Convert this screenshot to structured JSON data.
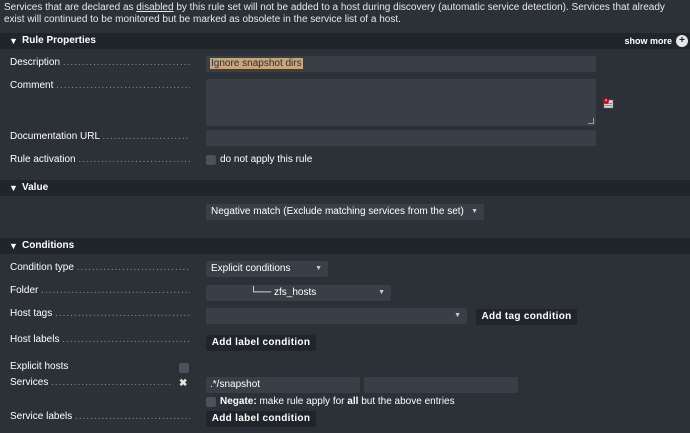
{
  "intro": {
    "part1": "Services that are declared as ",
    "link": "disabled",
    "part2": " by this rule set will not be added to a host during discovery (automatic service detection). Services that already exist will continued to be monitored but be marked as obsolete in the service list of a host."
  },
  "rule_properties": {
    "title": "Rule Properties",
    "show_more": "show more",
    "description_label": "Description",
    "description_value": "Ignore snapshot dirs",
    "comment_label": "Comment",
    "comment_value": "",
    "doc_url_label": "Documentation URL",
    "doc_url_value": "",
    "activation_label": "Rule activation",
    "activation_text": "do not apply this rule"
  },
  "value": {
    "title": "Value",
    "match_selected": "Negative match (Exclude matching services from the set)"
  },
  "conditions": {
    "title": "Conditions",
    "condition_type_label": "Condition type",
    "condition_type_value": "Explicit conditions",
    "folder_label": "Folder",
    "folder_value": "└── zfs_hosts",
    "host_tags_label": "Host tags",
    "host_tags_value": "",
    "add_tag_condition": "Add tag condition",
    "host_labels_label": "Host labels",
    "add_label_condition": "Add label condition",
    "explicit_hosts_label": "Explicit hosts",
    "services_label": "Services",
    "service_value_1": ".*/snapshot",
    "service_value_2": "",
    "negate_bold": "Negate:",
    "negate_text_1": " make rule apply for ",
    "negate_all": "all",
    "negate_text_2": " but the above entries",
    "service_labels_label": "Service labels",
    "add_service_label_condition": "Add label condition"
  },
  "colors": {
    "background": "#2b3137",
    "header": "#1f252b",
    "input": "#383f47",
    "highlight": "#c8a57a"
  }
}
